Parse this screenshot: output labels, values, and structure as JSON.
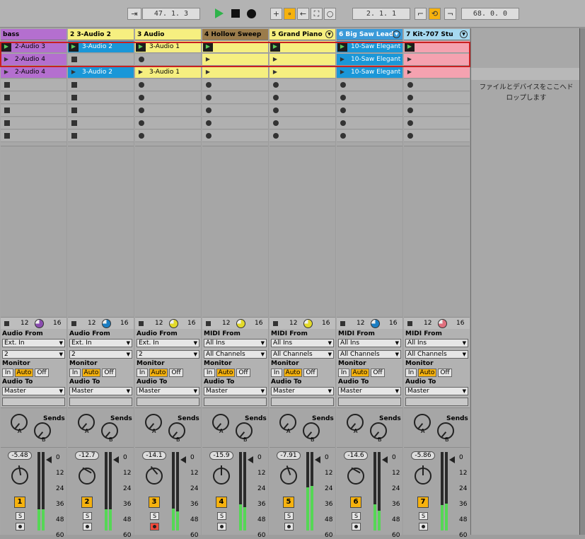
{
  "transport": {
    "arrangement_pos": "47.  1.  3",
    "loop_start": "2.  1.  1",
    "loop_length": "68.  0.  0"
  },
  "colors": {
    "bass": "#b46fcf",
    "yellow": "#f6ef80",
    "blue": "#1a97d8",
    "pink": "#f5a2b0",
    "brown": "#9b7c4b",
    "header_blue": "#3b9ad9"
  },
  "drop_text": "ファイルとデバイスをここへドロップします",
  "tracks": [
    {
      "name": "bass",
      "color": "#b46fcf",
      "clips": [
        "2-Audio 3",
        "2-Audio 4",
        "2-Audio 4"
      ],
      "vol": "-5.48",
      "num": "1",
      "in_type": "Audio From",
      "in_src": "Ext. In",
      "in_ch": "2",
      "pie": "#8b4db0"
    },
    {
      "name": "2 3-Audio 2",
      "color": "#f6ef80",
      "clips": [
        "3-Audio 2",
        "",
        "3-Audio 2"
      ],
      "vol": "-12.7",
      "num": "2",
      "in_type": "Audio From",
      "in_src": "Ext. In",
      "in_ch": "2",
      "pie": "#1a7dc2"
    },
    {
      "name": "3 Audio",
      "color": "#f6ef80",
      "clips": [
        "3-Audio 1",
        "",
        "3-Audio 1"
      ],
      "vol": "-14.1",
      "num": "3",
      "in_type": "Audio From",
      "in_src": "Ext. In",
      "in_ch": "2",
      "pie": "#e3da2a"
    },
    {
      "name": "4 Hollow Sweep",
      "color": "#9b7c4b",
      "clips": [
        "",
        "",
        ""
      ],
      "vol": "-15.9",
      "num": "4",
      "in_type": "MIDI From",
      "in_src": "All Ins",
      "in_ch": "All Channels",
      "pie": "#e3da2a"
    },
    {
      "name": "5 Grand Piano",
      "color": "#f6ef80",
      "clips": [
        "",
        "",
        ""
      ],
      "vol": "-7.91",
      "num": "5",
      "in_type": "MIDI From",
      "in_src": "All Ins",
      "in_ch": "All Channels",
      "pie": "#e3da2a"
    },
    {
      "name": "6 Big Saw Lead",
      "color": "#3b9ad9",
      "clips": [
        "10-Saw Elegant",
        "10-Saw Elegant",
        "10-Saw Elegant"
      ],
      "vol": "-14.6",
      "num": "6",
      "in_type": "MIDI From",
      "in_src": "All Ins",
      "in_ch": "All Channels",
      "pie": "#1a7dc2"
    },
    {
      "name": "7 Kit-707 Stu",
      "color": "#a6d9f0",
      "clips": [
        "",
        "",
        ""
      ],
      "vol": "-5.86",
      "num": "7",
      "in_type": "MIDI From",
      "in_src": "All Ins",
      "in_ch": "All Channels",
      "pie": "#e0707e"
    }
  ],
  "labels": {
    "monitor": "Monitor",
    "in": "In",
    "auto": "Auto",
    "off": "Off",
    "audio_to": "Audio To",
    "master": "Master",
    "sends": "Sends",
    "solo": "S",
    "knob_a": "A",
    "knob_b": "B",
    "n12": "12",
    "n16": "16"
  },
  "scale": [
    "0",
    "12",
    "24",
    "36",
    "48",
    "60"
  ]
}
